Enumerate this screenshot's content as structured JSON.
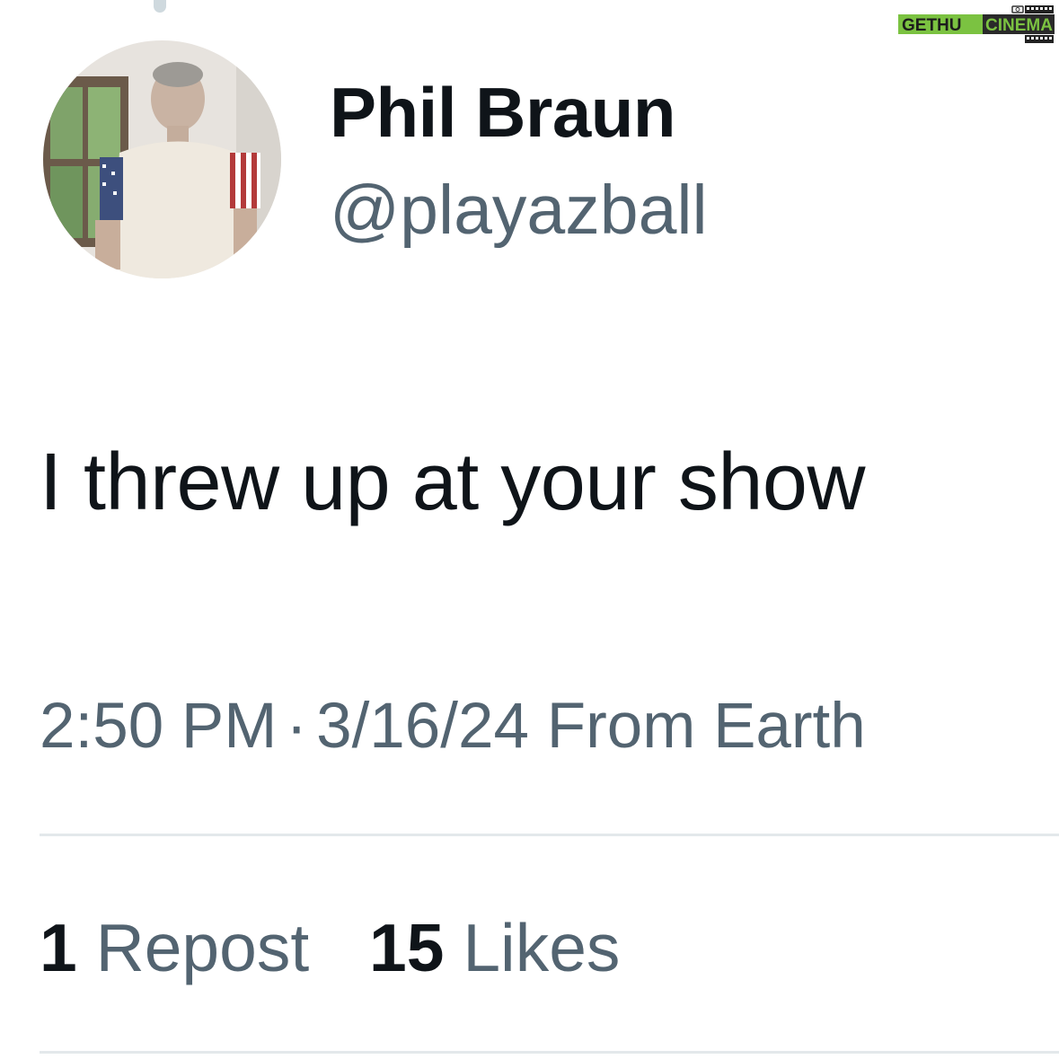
{
  "author": {
    "display_name": "Phil Braun",
    "handle": "@playazball"
  },
  "post": {
    "text": "I threw up at your show"
  },
  "meta": {
    "time": "2:50 PM",
    "separator": "·",
    "date": "3/16/24",
    "source": "From Earth"
  },
  "stats": [
    {
      "count": "1",
      "label": "Repost"
    },
    {
      "count": "15",
      "label": "Likes"
    }
  ],
  "watermark": {
    "text": "GETHUCINEMA",
    "part1": "GETHU",
    "part2": "CINEMA"
  },
  "colors": {
    "primary_text": "#0f1419",
    "secondary_text": "#536471",
    "divider": "#e3e8eb",
    "watermark_green": "#7bc241"
  }
}
